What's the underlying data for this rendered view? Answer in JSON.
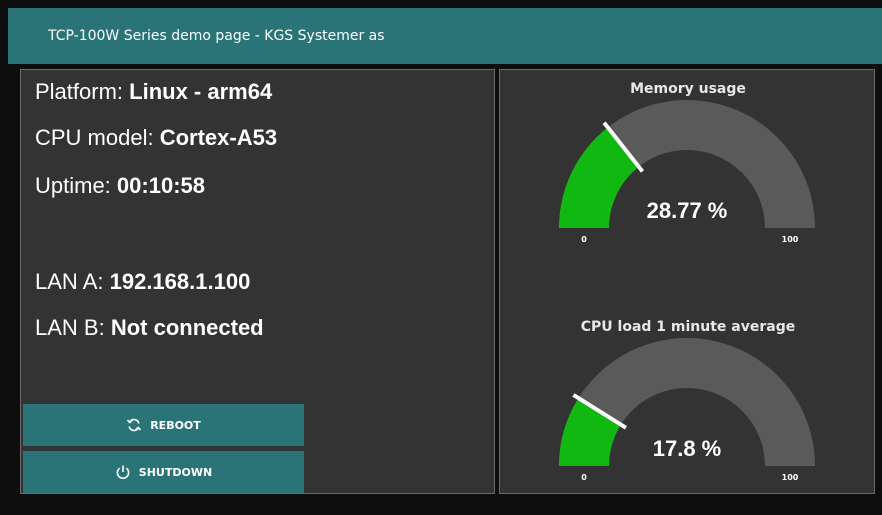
{
  "header": {
    "title": "TCP-100W Series demo page - KGS Systemer as"
  },
  "system_info": {
    "platform_label": "Platform:",
    "platform_value": "Linux - arm64",
    "cpu_label": "CPU model:",
    "cpu_value": "Cortex-A53",
    "uptime_label": "Uptime:",
    "uptime_value": "00:10:58",
    "lan_a_label": "LAN A:",
    "lan_a_value": "192.168.1.100",
    "lan_b_label": "LAN B:",
    "lan_b_value": "Not connected"
  },
  "actions": {
    "reboot_label": "REBOOT",
    "reboot_icon": "refresh-icon",
    "shutdown_label": "SHUTDOWN",
    "shutdown_icon": "power-icon"
  },
  "gauges": {
    "memory": {
      "title": "Memory usage",
      "value": 28.77,
      "value_text": "28.77 %",
      "min_label": "0",
      "max_label": "100",
      "min": 0,
      "max": 100
    },
    "cpu": {
      "title": "CPU load 1 minute average",
      "value": 17.8,
      "value_text": "17.8 %",
      "min_label": "0",
      "max_label": "100",
      "min": 0,
      "max": 100
    }
  },
  "colors": {
    "header_bg": "#2a7478",
    "panel_bg": "#333333",
    "gauge_fill": "#11b811",
    "gauge_track": "#5a5a5a",
    "button_bg": "#2a7478"
  }
}
